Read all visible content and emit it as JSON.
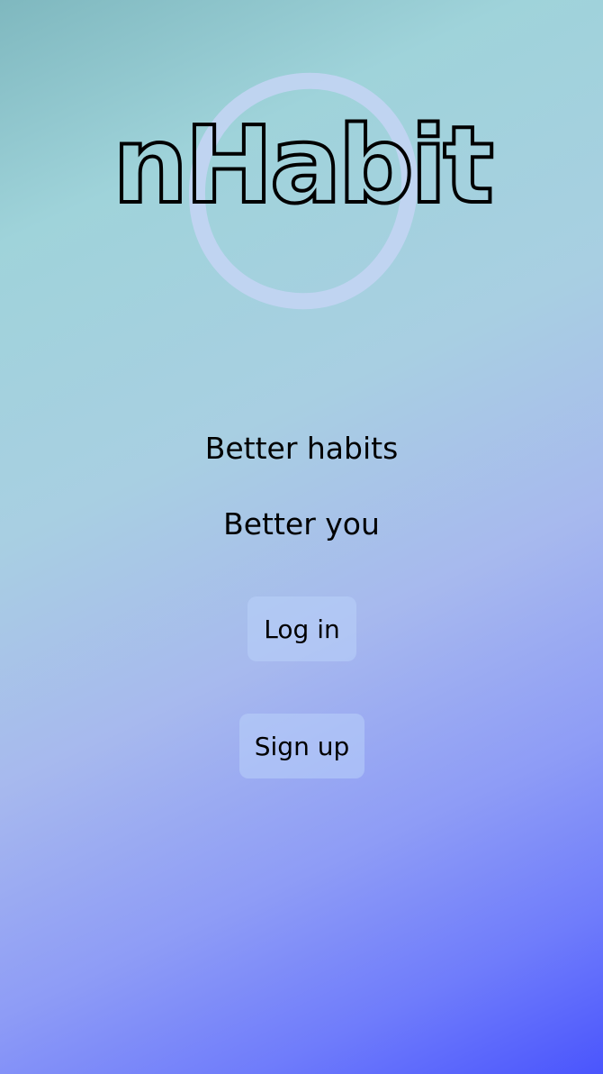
{
  "logo": {
    "text": "nHabit",
    "ring_icon": "circle-icon",
    "ring_color": "#c3d4f3"
  },
  "tagline": {
    "line1": "Better habits",
    "line2": "Better you"
  },
  "actions": {
    "login_label": "Log in",
    "signup_label": "Sign up"
  },
  "colors": {
    "gradient_start": "#7fb8bf",
    "gradient_end": "#4a55fd",
    "button_bg": "#b9d2fa"
  }
}
